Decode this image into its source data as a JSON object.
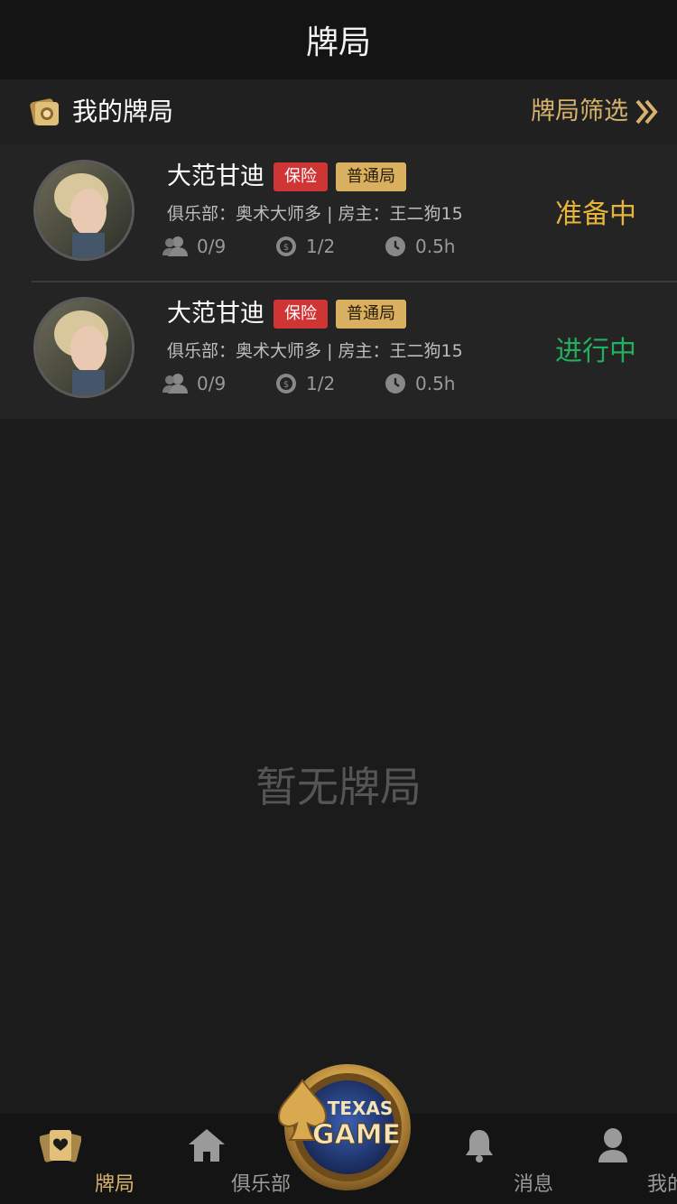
{
  "header": {
    "title": "牌局"
  },
  "section": {
    "label": "我的牌局",
    "filter_label": "牌局筛选"
  },
  "games": [
    {
      "name": "大范甘迪",
      "tags": [
        "保险",
        "普通局"
      ],
      "club_label": "俱乐部：",
      "club": "奥术大师多",
      "separator": "|",
      "host_label": "房主：",
      "host": "王二狗15",
      "players": "0/9",
      "blinds": "1/2",
      "duration": "0.5h",
      "status": "准备中",
      "status_color": "#e8b33a"
    },
    {
      "name": "大范甘迪",
      "tags": [
        "保险",
        "普通局"
      ],
      "club_label": "俱乐部：",
      "club": "奥术大师多",
      "separator": "|",
      "host_label": "房主：",
      "host": "王二狗15",
      "players": "0/9",
      "blinds": "1/2",
      "duration": "0.5h",
      "status": "进行中",
      "status_color": "#22b05e"
    }
  ],
  "empty_text": "暂无牌局",
  "tabbar": {
    "items": [
      {
        "label": "牌局",
        "icon": "cards-icon",
        "active": true
      },
      {
        "label": "俱乐部",
        "icon": "home-icon",
        "active": false
      },
      {
        "label": "",
        "icon": "texas-game-logo",
        "active": false
      },
      {
        "label": "消息",
        "icon": "bell-icon",
        "active": false
      },
      {
        "label": "我的",
        "icon": "user-icon",
        "active": false
      }
    ],
    "logo_line1": "TEXAS",
    "logo_line2": "GAME"
  },
  "colors": {
    "accent": "#d6b26c",
    "tag_red": "#d03535",
    "tag_gold": "#d9b060",
    "ready": "#e8b33a",
    "playing": "#22b05e"
  }
}
